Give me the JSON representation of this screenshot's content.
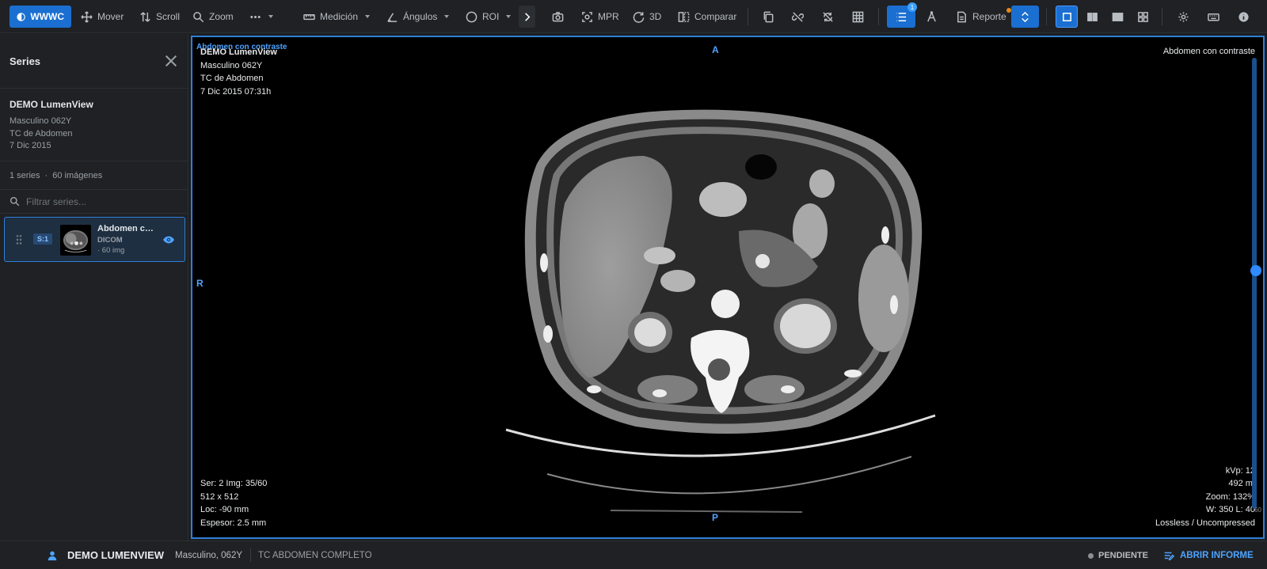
{
  "toolbar": {
    "wwwc": "WWWC",
    "mover": "Mover",
    "scroll": "Scroll",
    "zoom": "Zoom",
    "medicion": "Medición",
    "angulos": "Ángulos",
    "roi": "ROI",
    "mpr": "MPR",
    "three_d": "3D",
    "comparar": "Comparar",
    "reporte": "Reporte",
    "series_badge": "1"
  },
  "sidebar": {
    "title": "Series",
    "patient_name": "DEMO LumenView",
    "patient_sex_age": "Masculino 062Y",
    "study": "TC de Abdomen",
    "date": "7 Dic 2015",
    "series_count": "1 series",
    "dot": "·",
    "image_count": "60 imágenes",
    "filter_placeholder": "Filtrar series...",
    "series": [
      {
        "tag": "S:1",
        "name": "Abdomen con contraste",
        "modality": "DICOM",
        "count": "· 60 img"
      }
    ]
  },
  "viewport": {
    "series_title": "Abdomen con contraste",
    "top_left": [
      "DEMO LumenView",
      "Masculino 062Y",
      "TC de Abdomen",
      "7 Dic 2015 07:31h"
    ],
    "top_right": "Abdomen con contraste",
    "bottom_left": [
      "Ser: 2 Img: 35/60",
      "512 x 512",
      "Loc: -90 mm",
      "Espesor: 2.5 mm"
    ],
    "bottom_right": [
      "kVp: 12",
      "492 m.",
      "Zoom: 132%",
      "W: 350 L: 40",
      "Lossless / Uncompressed"
    ],
    "orient_top": "A",
    "orient_left": "R",
    "orient_bottom": "P",
    "scroll_label": "60",
    "scroll_position": 0.58
  },
  "status": {
    "patient": "DEMO LUMENVIEW",
    "info": "Masculino, 062Y",
    "study": "TC ABDOMEN COMPLETO",
    "pending": "PENDIENTE",
    "open_report": "ABRIR INFORME"
  },
  "colors": {
    "accent": "#1a6fd1",
    "highlight": "#4ea3ff",
    "pending_dot": "#e88a1a"
  }
}
